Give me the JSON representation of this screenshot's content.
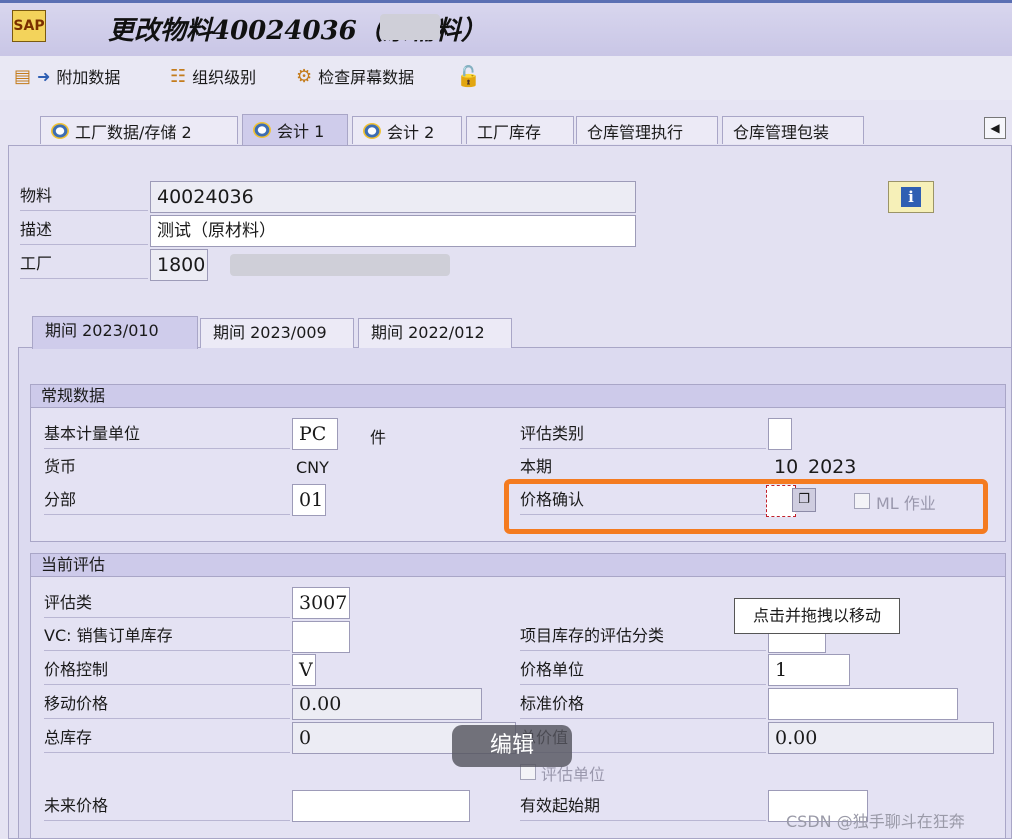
{
  "window": {
    "title": "更改物料40024036（原辅料）"
  },
  "toolbar": {
    "items": [
      {
        "label": "附加数据"
      },
      {
        "label": "组织级别"
      },
      {
        "label": "检查屏幕数据"
      }
    ]
  },
  "tabs": [
    {
      "label": "工厂数据/存储 2"
    },
    {
      "label": "会计 1",
      "active": true
    },
    {
      "label": "会计 2"
    },
    {
      "label": "工厂库存"
    },
    {
      "label": "仓库管理执行"
    },
    {
      "label": "仓库管理包装"
    }
  ],
  "header": {
    "material_label": "物料",
    "material_value": "40024036",
    "desc_label": "描述",
    "desc_value": "测试（原材料）",
    "plant_label": "工厂",
    "plant_value": "1800"
  },
  "period_tabs": [
    {
      "label": "期间 2023/010",
      "active": true
    },
    {
      "label": "期间 2023/009"
    },
    {
      "label": "期间 2022/012"
    }
  ],
  "general": {
    "title": "常规数据",
    "base_uom_label": "基本计量单位",
    "base_uom_value": "PC",
    "base_uom_text": "件",
    "currency_label": "货币",
    "currency_value": "CNY",
    "division_label": "分部",
    "division_value": "01",
    "valuation_cat_label": "评估类别",
    "valuation_cat_value": "",
    "current_period_label": "本期",
    "current_period_month": "10",
    "current_period_year": "2023",
    "price_determ_label": "价格确认",
    "price_determ_value": "",
    "ml_label": "ML 作业"
  },
  "valuation": {
    "title": "当前评估",
    "val_class_label": "评估类",
    "val_class_value": "3007",
    "vc_label": "VC: 销售订单库存",
    "vc_value": "",
    "proj_label": "项目库存的评估分类",
    "price_ctrl_label": "价格控制",
    "price_ctrl_value": "V",
    "price_unit_label": "价格单位",
    "price_unit_value": "1",
    "mov_price_label": "移动价格",
    "mov_price_value": "0.00",
    "std_price_label": "标准价格",
    "std_price_value": "",
    "total_stock_label": "总库存",
    "total_stock_value": "0",
    "total_value_label": "总价值",
    "total_value_value": "0.00",
    "val_unit_label": "评估单位",
    "future_price_label": "未来价格",
    "future_price_value": "",
    "valid_from_label": "有效起始期",
    "valid_from_value": ""
  },
  "tooltip": {
    "text": "点击并拖拽以移动"
  },
  "overlay": {
    "edit_label": "编辑"
  },
  "watermark": {
    "text": "CSDN @独手聊斗在狂奔"
  }
}
